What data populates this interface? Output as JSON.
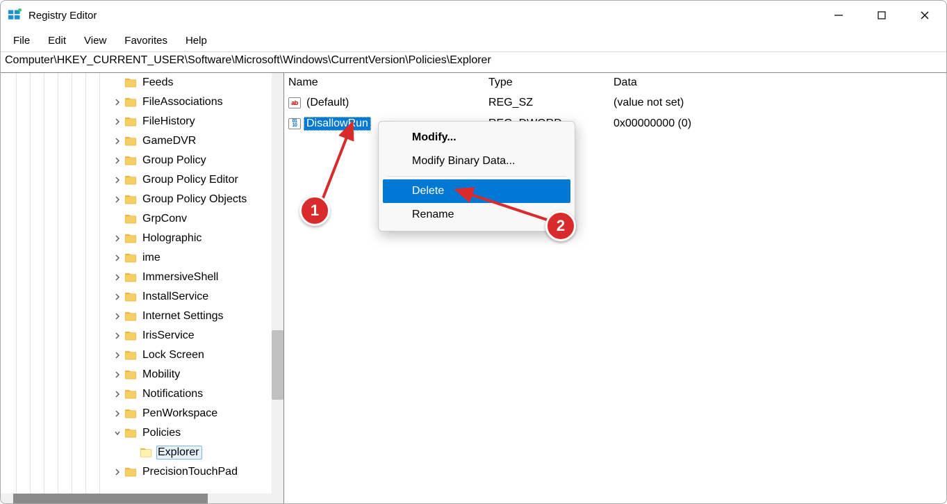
{
  "window": {
    "title": "Registry Editor"
  },
  "menu": {
    "file": "File",
    "edit": "Edit",
    "view": "View",
    "favorites": "Favorites",
    "help": "Help"
  },
  "address": "Computer\\HKEY_CURRENT_USER\\Software\\Microsoft\\Windows\\CurrentVersion\\Policies\\Explorer",
  "tree": {
    "items": [
      {
        "label": "Feeds",
        "depth": 8,
        "expander": "none"
      },
      {
        "label": "FileAssociations",
        "depth": 8,
        "expander": "closed"
      },
      {
        "label": "FileHistory",
        "depth": 8,
        "expander": "closed"
      },
      {
        "label": "GameDVR",
        "depth": 8,
        "expander": "closed"
      },
      {
        "label": "Group Policy",
        "depth": 8,
        "expander": "closed"
      },
      {
        "label": "Group Policy Editor",
        "depth": 8,
        "expander": "closed"
      },
      {
        "label": "Group Policy Objects",
        "depth": 8,
        "expander": "closed"
      },
      {
        "label": "GrpConv",
        "depth": 8,
        "expander": "none"
      },
      {
        "label": "Holographic",
        "depth": 8,
        "expander": "closed"
      },
      {
        "label": "ime",
        "depth": 8,
        "expander": "closed"
      },
      {
        "label": "ImmersiveShell",
        "depth": 8,
        "expander": "closed"
      },
      {
        "label": "InstallService",
        "depth": 8,
        "expander": "closed"
      },
      {
        "label": "Internet Settings",
        "depth": 8,
        "expander": "closed"
      },
      {
        "label": "IrisService",
        "depth": 8,
        "expander": "closed"
      },
      {
        "label": "Lock Screen",
        "depth": 8,
        "expander": "closed"
      },
      {
        "label": "Mobility",
        "depth": 8,
        "expander": "closed"
      },
      {
        "label": "Notifications",
        "depth": 8,
        "expander": "closed"
      },
      {
        "label": "PenWorkspace",
        "depth": 8,
        "expander": "closed"
      },
      {
        "label": "Policies",
        "depth": 8,
        "expander": "open"
      },
      {
        "label": "Explorer",
        "depth": 9,
        "expander": "none",
        "selected": true
      },
      {
        "label": "PrecisionTouchPad",
        "depth": 8,
        "expander": "closed"
      }
    ]
  },
  "list": {
    "headers": {
      "name": "Name",
      "type": "Type",
      "data": "Data"
    },
    "rows": [
      {
        "icon": "str",
        "name": "(Default)",
        "type": "REG_SZ",
        "data": "(value not set)",
        "selected": false
      },
      {
        "icon": "bin",
        "name": "DisallowRun",
        "type": "REG_DWORD",
        "data": "0x00000000 (0)",
        "selected": true
      }
    ]
  },
  "contextMenu": {
    "modify": "Modify...",
    "modifyBinary": "Modify Binary Data...",
    "delete": "Delete",
    "rename": "Rename"
  },
  "annotations": {
    "one": "1",
    "two": "2"
  }
}
